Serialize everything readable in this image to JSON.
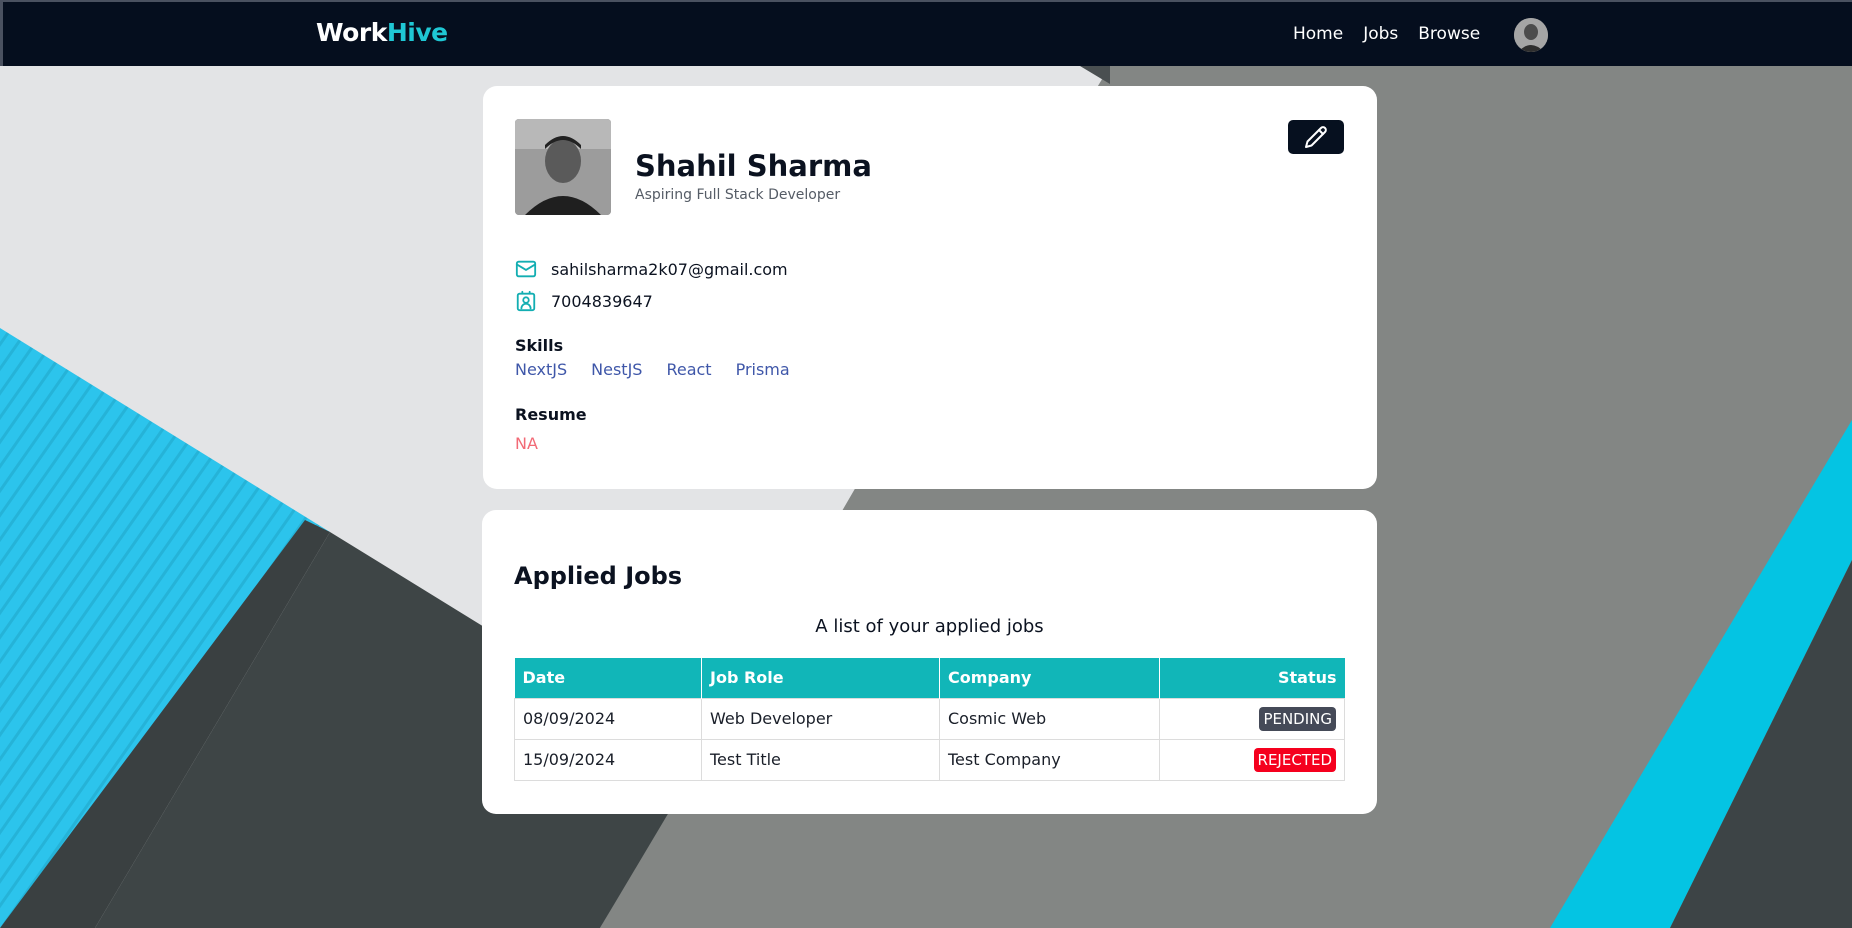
{
  "brand": {
    "part1": "Work",
    "part2": "Hive"
  },
  "nav": {
    "items": [
      {
        "label": "Home"
      },
      {
        "label": "Jobs"
      },
      {
        "label": "Browse"
      }
    ]
  },
  "profile": {
    "name": "Shahil Sharma",
    "headline": "Aspiring Full Stack Developer",
    "email": "sahilsharma2k07@gmail.com",
    "phone": "7004839647",
    "skills_label": "Skills",
    "skills": [
      "NextJS",
      "NestJS",
      "React",
      "Prisma"
    ],
    "resume_label": "Resume",
    "resume_value": "NA"
  },
  "applied": {
    "title": "Applied Jobs",
    "caption": "A list of your applied jobs",
    "columns": [
      "Date",
      "Job Role",
      "Company",
      "Status"
    ],
    "rows": [
      {
        "date": "08/09/2024",
        "role": "Web Developer",
        "company": "Cosmic Web",
        "status": "PENDING"
      },
      {
        "date": "15/09/2024",
        "role": "Test Title",
        "company": "Test Company",
        "status": "REJECTED"
      }
    ]
  },
  "colors": {
    "navbar": "#050e1e",
    "brand_accent": "#1fc7d4",
    "table_header": "#11b6b8",
    "skill_link": "#3f57a9",
    "resume_na": "#f26a76",
    "status_pending": "#454a58",
    "status_rejected": "#f5001e"
  }
}
